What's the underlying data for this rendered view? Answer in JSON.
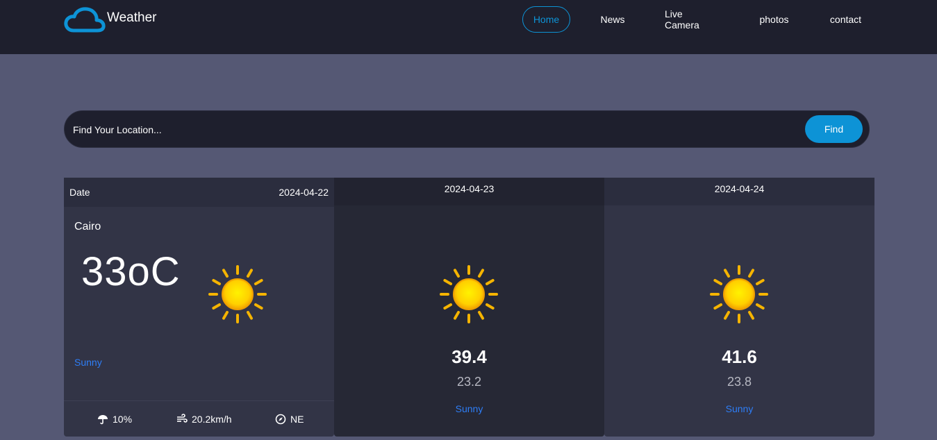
{
  "brand": {
    "name": "Weather",
    "logo_icon": "cloud-icon",
    "accent": "#0d93d6"
  },
  "nav": {
    "items": [
      {
        "label": "Home",
        "active": true
      },
      {
        "label": "News",
        "active": false
      },
      {
        "label": "Live Camera",
        "active": false
      },
      {
        "label": "photos",
        "active": false
      },
      {
        "label": "contact",
        "active": false
      }
    ]
  },
  "search": {
    "placeholder": "Find Your Location...",
    "button_label": "Find"
  },
  "today": {
    "date_label": "Date",
    "date": "2024-04-22",
    "city": "Cairo",
    "temp": "33oC",
    "icon": "sun-icon",
    "condition": "Sunny",
    "rain": "10%",
    "wind": "20.2km/h",
    "direction": "NE"
  },
  "forecast": [
    {
      "date": "2024-04-23",
      "max": "39.4",
      "min": "23.2",
      "condition": "Sunny",
      "icon": "sun-icon"
    },
    {
      "date": "2024-04-24",
      "max": "41.6",
      "min": "23.8",
      "condition": "Sunny",
      "icon": "sun-icon"
    }
  ],
  "colors": {
    "page_bg": "#555874",
    "header_bg": "#1e1f2d",
    "condition_text": "#2e7ef7"
  }
}
